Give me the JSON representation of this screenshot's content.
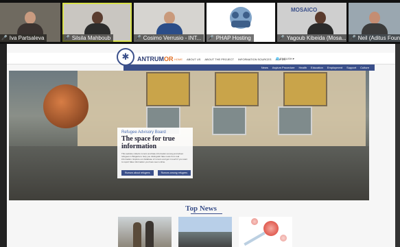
{
  "participants": [
    {
      "name": "Iva Partsaleva",
      "muted": false,
      "highlighted": false,
      "bg": "#6f6a60"
    },
    {
      "name": "Silsila Mahboub",
      "muted": false,
      "highlighted": true,
      "bg": "#c9c6c1"
    },
    {
      "name": "Cosimo Verrusio - INT...",
      "muted": true,
      "highlighted": false,
      "bg": "#d6d4d0"
    },
    {
      "name": "PHAP Hosting",
      "muted": true,
      "highlighted": false,
      "bg": "#ffffff"
    },
    {
      "name": "Yagoub Kibeida (Mosa...",
      "muted": true,
      "highlighted": false,
      "bg": "#cfcfcf"
    },
    {
      "name": "Neil (Aditus Foun...",
      "muted": true,
      "highlighted": false,
      "bg": "#9aa7b0"
    }
  ],
  "tile_logo": "MOSAICO",
  "website": {
    "brand_main": "ANTRUM",
    "brand_accent": "OR",
    "menu": [
      "HOME",
      "ABOUT US",
      "ABOUT THE PROJECT",
      "INFORMATION SOURCES",
      "ASK US"
    ],
    "language": "ENGLISH",
    "subnav": [
      "News",
      "Asylum Procedure",
      "Health",
      "Education",
      "Employment",
      "Support",
      "Culture"
    ],
    "hero": {
      "tag": "Refugee Advisory Board",
      "title": "The space for true information",
      "text": "This website collects rumors and fake information among and about refugees in Bulgaria to help you distinguish fake news from real information. Explore our database of rumors and get in touch if you want to report false information you have seen online.",
      "button_1": "Rumors about refugees",
      "button_2": "Rumors among refugees"
    },
    "news_heading": "Top News"
  },
  "colors": {
    "accent": "#3a4f8a",
    "brand_orange": "#e06b1e",
    "speaker_highlight": "#d8e14a"
  }
}
